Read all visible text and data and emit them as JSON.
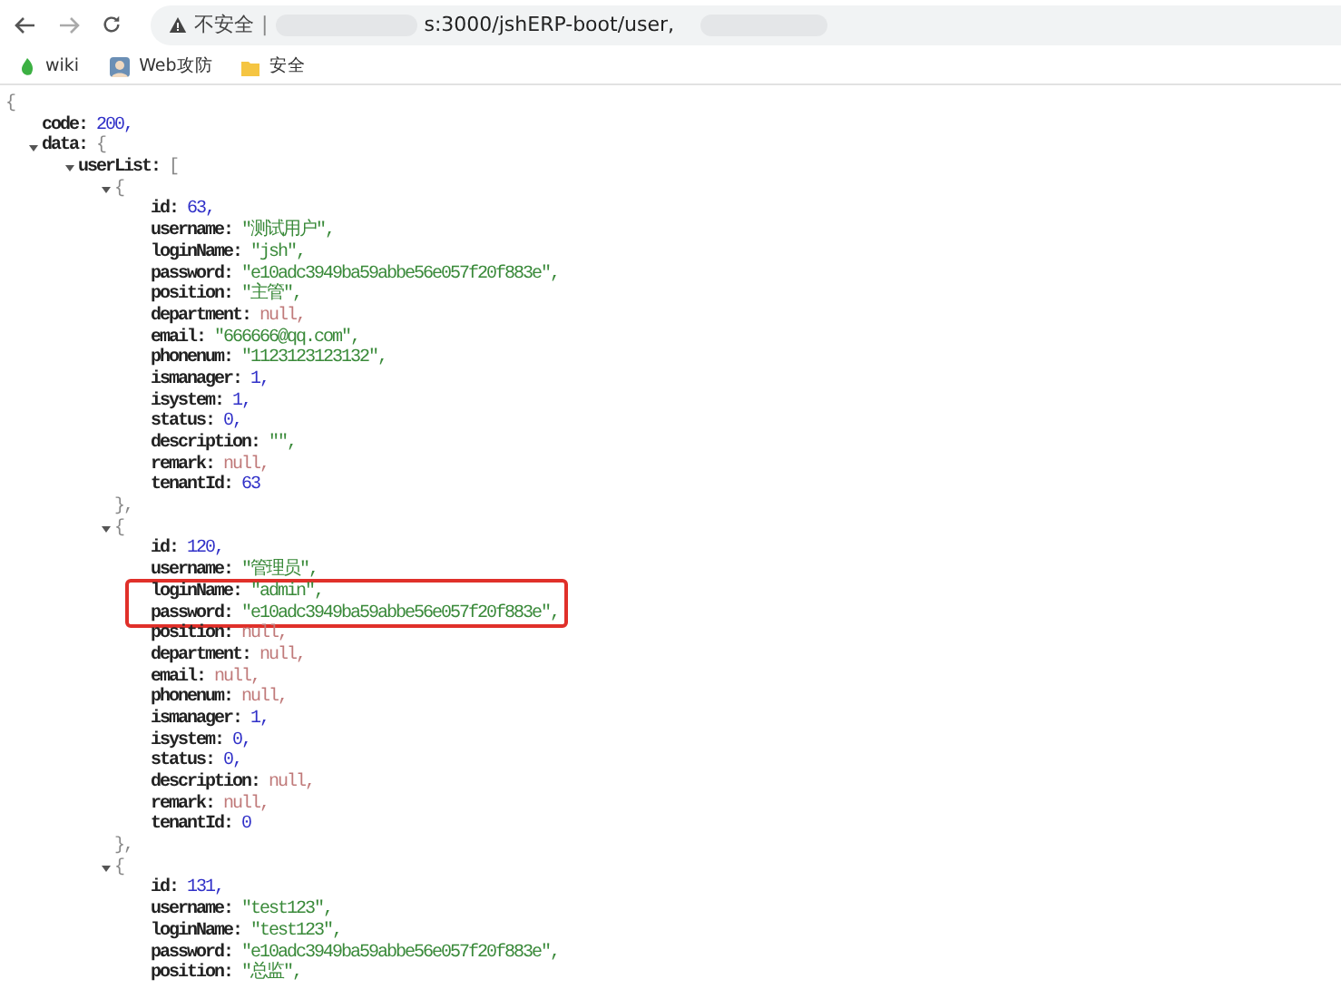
{
  "browser": {
    "address": {
      "security_label": "不安全",
      "separator": "|",
      "url": "s:3000/jshERP-boot/user,"
    },
    "bookmarks": [
      {
        "kind": "wiki",
        "label": "wiki"
      },
      {
        "kind": "avatar",
        "label": "Web攻防"
      },
      {
        "kind": "folder",
        "label": "安全"
      }
    ]
  },
  "viewer": {
    "root": {
      "kind": "branch",
      "open": "{",
      "children": [
        {
          "kind": "number",
          "key": "code:",
          "value": "200,"
        },
        {
          "kind": "branch",
          "key": "data:",
          "open": "{",
          "expanded": true,
          "children": [
            {
              "kind": "branch",
              "key": "userList:",
              "open": "[",
              "expanded": true,
              "children": [
                {
                  "kind": "branch",
                  "open": "{",
                  "expanded": true,
                  "close": "},",
                  "children": [
                    {
                      "kind": "number",
                      "key": "id:",
                      "value": "63,"
                    },
                    {
                      "kind": "string",
                      "key": "username:",
                      "value": "\"测试用户\","
                    },
                    {
                      "kind": "string",
                      "key": "loginName:",
                      "value": "\"jsh\","
                    },
                    {
                      "kind": "string",
                      "key": "password:",
                      "value": "\"e10adc3949ba59abbe56e057f20f883e\","
                    },
                    {
                      "kind": "string",
                      "key": "position:",
                      "value": "\"主管\","
                    },
                    {
                      "kind": "null",
                      "key": "department:",
                      "value": "null,"
                    },
                    {
                      "kind": "string",
                      "key": "email:",
                      "value": "\"666666@qq.com\","
                    },
                    {
                      "kind": "string",
                      "key": "phonenum:",
                      "value": "\"1123123123132\","
                    },
                    {
                      "kind": "number",
                      "key": "ismanager:",
                      "value": "1,"
                    },
                    {
                      "kind": "number",
                      "key": "isystem:",
                      "value": "1,"
                    },
                    {
                      "kind": "number",
                      "key": "status:",
                      "value": "0,"
                    },
                    {
                      "kind": "string",
                      "key": "description:",
                      "value": "\"\","
                    },
                    {
                      "kind": "null",
                      "key": "remark:",
                      "value": "null,"
                    },
                    {
                      "kind": "number",
                      "key": "tenantId:",
                      "value": "63"
                    }
                  ]
                },
                {
                  "kind": "branch",
                  "open": "{",
                  "expanded": true,
                  "close": "},",
                  "children": [
                    {
                      "kind": "number",
                      "key": "id:",
                      "value": "120,"
                    },
                    {
                      "kind": "string",
                      "key": "username:",
                      "value": "\"管理员\","
                    },
                    {
                      "kind": "highlight",
                      "children": [
                        {
                          "kind": "string",
                          "key": "loginName:",
                          "value": "\"admin\","
                        },
                        {
                          "kind": "string",
                          "key": "password:",
                          "value": "\"e10adc3949ba59abbe56e057f20f883e\","
                        }
                      ]
                    },
                    {
                      "kind": "null",
                      "key": "position:",
                      "value": "null,"
                    },
                    {
                      "kind": "null",
                      "key": "department:",
                      "value": "null,"
                    },
                    {
                      "kind": "null",
                      "key": "email:",
                      "value": "null,"
                    },
                    {
                      "kind": "null",
                      "key": "phonenum:",
                      "value": "null,"
                    },
                    {
                      "kind": "number",
                      "key": "ismanager:",
                      "value": "1,"
                    },
                    {
                      "kind": "number",
                      "key": "isystem:",
                      "value": "0,"
                    },
                    {
                      "kind": "number",
                      "key": "status:",
                      "value": "0,"
                    },
                    {
                      "kind": "null",
                      "key": "description:",
                      "value": "null,"
                    },
                    {
                      "kind": "null",
                      "key": "remark:",
                      "value": "null,"
                    },
                    {
                      "kind": "number",
                      "key": "tenantId:",
                      "value": "0"
                    }
                  ]
                },
                {
                  "kind": "branch",
                  "open": "{",
                  "expanded": true,
                  "children": [
                    {
                      "kind": "number",
                      "key": "id:",
                      "value": "131,"
                    },
                    {
                      "kind": "string",
                      "key": "username:",
                      "value": "\"test123\","
                    },
                    {
                      "kind": "string",
                      "key": "loginName:",
                      "value": "\"test123\","
                    },
                    {
                      "kind": "string",
                      "key": "password:",
                      "value": "\"e10adc3949ba59abbe56e057f20f883e\","
                    },
                    {
                      "kind": "string",
                      "key": "position:",
                      "value": "\"总监\","
                    }
                  ]
                }
              ]
            }
          ]
        }
      ]
    }
  }
}
